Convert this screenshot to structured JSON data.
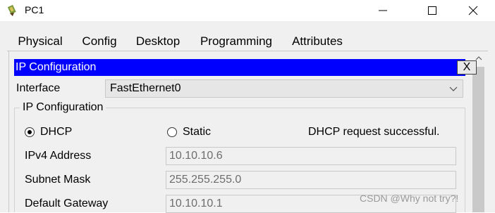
{
  "window": {
    "title": "PC1",
    "app_icon": "packet-tracer-pc-icon",
    "controls": [
      "minimize-icon",
      "maximize-icon",
      "close-icon"
    ]
  },
  "tabs": [
    {
      "label": "Physical",
      "active": false
    },
    {
      "label": "Config",
      "active": false
    },
    {
      "label": "Desktop",
      "active": true
    },
    {
      "label": "Programming",
      "active": false
    },
    {
      "label": "Attributes",
      "active": false
    }
  ],
  "ip_config": {
    "header_title": "IP Configuration",
    "close_label": "X",
    "interface_label": "Interface",
    "interface_value": "FastEthernet0",
    "group_title": "IP Configuration",
    "dhcp_label": "DHCP",
    "static_label": "Static",
    "selected_mode": "DHCP",
    "status_text": "DHCP request successful.",
    "ipv4_label": "IPv4 Address",
    "ipv4_value": "10.10.10.6",
    "mask_label": "Subnet Mask",
    "mask_value": "255.255.255.0",
    "gateway_label": "Default Gateway",
    "gateway_value": "10.10.10.1"
  },
  "watermark": "CSDN @Why not try?!",
  "colors": {
    "header_bg": "#0000ff",
    "active_tab_underline": "#1c3f7a",
    "panel_bg": "#f0f0f0"
  }
}
